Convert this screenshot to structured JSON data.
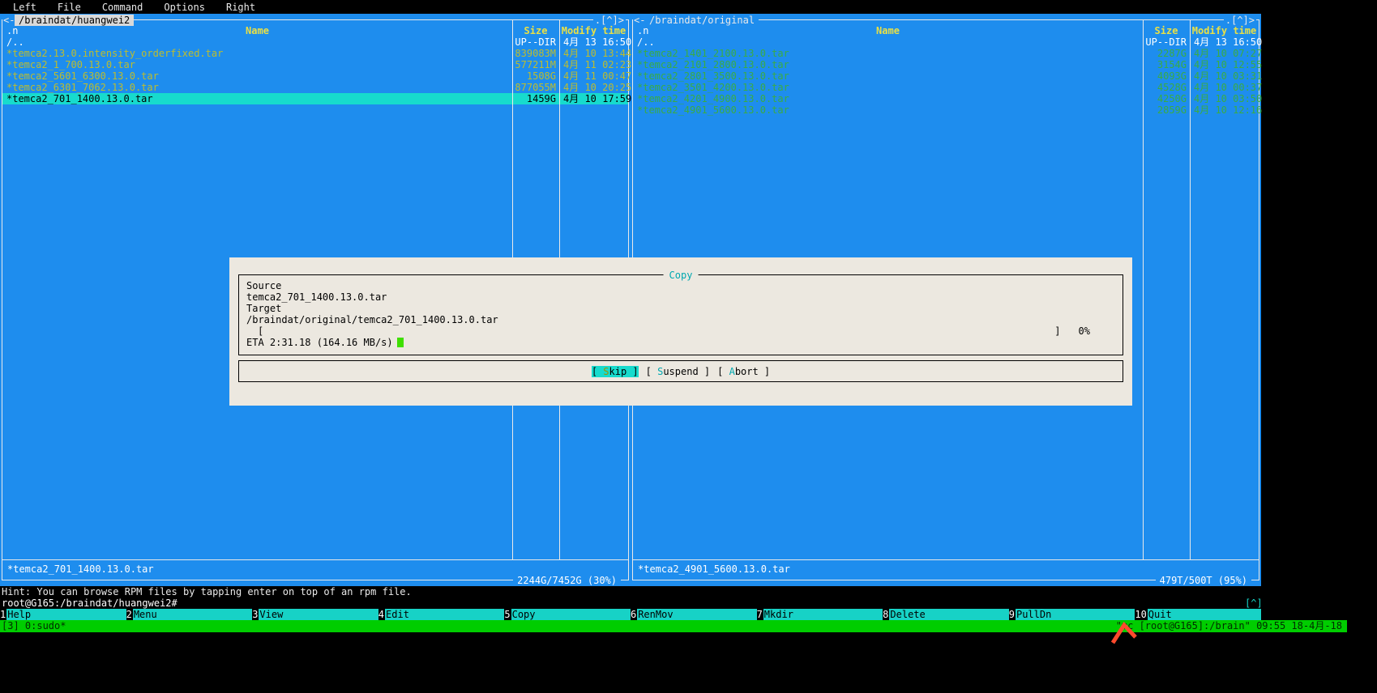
{
  "colors": {
    "panel_bg": "#1e8dee",
    "panel_frame": "#e9e9e9",
    "column_header_text": "#e9e045",
    "left_files_text": "#bdbd2e",
    "right_files_text": "#3aac43",
    "selection_bg": "#17dbcd",
    "dialog_bg": "#ece8e0",
    "dialog_title_text": "#00a8b0",
    "fkey_label_bg": "#17d2c6",
    "statusbar_bg": "#00cd00",
    "eta_cursor": "#3fdf00"
  },
  "menu_bar": {
    "items": [
      "Left",
      "File",
      "Command",
      "Options",
      "Right"
    ]
  },
  "left_panel": {
    "arrow": "<-",
    "path": "/braindat/huangwei2",
    "corner": ".[^]>",
    "sort_indicator": ".n",
    "columns": {
      "name": "Name",
      "size": "Size",
      "mtime": "Modify time"
    },
    "rows": [
      {
        "name": "/..",
        "size": "UP--DIR",
        "mtime": "4月 13 16:50"
      },
      {
        "name": "*temca2.13.0.intensity_orderfixed.tar",
        "size": "839083M",
        "mtime": "4月 10 13:44"
      },
      {
        "name": "*temca2_1_700.13.0.tar",
        "size": "577211M",
        "mtime": "4月 11 02:23"
      },
      {
        "name": "*temca2_5601_6300.13.0.tar",
        "size": "1508G",
        "mtime": "4月 11 00:47"
      },
      {
        "name": "*temca2_6301_7062.13.0.tar",
        "size": "877055M",
        "mtime": "4月 10 20:25"
      },
      {
        "name": "*temca2_701_1400.13.0.tar",
        "size": "1459G",
        "mtime": "4月 10 17:59"
      }
    ],
    "mini_status": "*temca2_701_1400.13.0.tar",
    "summary": "2244G/7452G (30%)"
  },
  "right_panel": {
    "arrow": "<-",
    "path": "/braindat/original",
    "corner": ".[^]>",
    "sort_indicator": ".n",
    "columns": {
      "name": "Name",
      "size": "Size",
      "mtime": "Modify time"
    },
    "rows": [
      {
        "name": "/..",
        "size": "UP--DIR",
        "mtime": "4月 13 16:50"
      },
      {
        "name": "*temca2_1401_2100.13.0.tar",
        "size": "2287G",
        "mtime": "4月 10 07:27"
      },
      {
        "name": "*temca2_2101_2800.13.0.tar",
        "size": "3154G",
        "mtime": "4月 10 12:55"
      },
      {
        "name": "*temca2_2801_3500.13.0.tar",
        "size": "4093G",
        "mtime": "4月 10 03:31"
      },
      {
        "name": "*temca2_3501_4200.13.0.tar",
        "size": "4528G",
        "mtime": "4月 10 00:37"
      },
      {
        "name": "*temca2_4201_4900.13.0.tar",
        "size": "4250G",
        "mtime": "4月 10 03:50"
      },
      {
        "name": "*temca2_4901_5600.13.0.tar",
        "size": "2859G",
        "mtime": "4月 10 12:16"
      }
    ],
    "mini_status": "*temca2_4901_5600.13.0.tar",
    "summary": "479T/500T (95%)"
  },
  "copy_dialog": {
    "title": "Copy",
    "source_label": "Source",
    "source_value": "temca2_701_1400.13.0.tar",
    "target_label": "Target",
    "target_value": "/braindat/original/temca2_701_1400.13.0.tar",
    "progress_open": "[",
    "progress_close": "]",
    "progress_percent": "0%",
    "eta_text": "ETA 2:31.18 (164.16 MB/s)",
    "buttons": [
      {
        "pre": "[ ",
        "hotkey": "S",
        "rest": "kip ]"
      },
      {
        "pre": "[ ",
        "hotkey": "S",
        "rest": "uspend ]"
      },
      {
        "pre": "[ ",
        "hotkey": "A",
        "rest": "bort ]"
      }
    ]
  },
  "hint_line": "Hint: You can browse RPM files by tapping enter on top of an rpm file.",
  "command_prompt": "root@G165:/braindat/huangwei2#",
  "corner_marker": "[^]",
  "function_keys": [
    {
      "num": "1",
      "label": "Help"
    },
    {
      "num": "2",
      "label": "Menu"
    },
    {
      "num": "3",
      "label": "View"
    },
    {
      "num": "4",
      "label": "Edit"
    },
    {
      "num": "5",
      "label": "Copy"
    },
    {
      "num": "6",
      "label": "RenMov"
    },
    {
      "num": "7",
      "label": "Mkdir"
    },
    {
      "num": "8",
      "label": "Delete"
    },
    {
      "num": "9",
      "label": "PullDn"
    },
    {
      "num": "10",
      "label": "Quit"
    }
  ],
  "status_bar": {
    "left": "[3] 0:sudo*",
    "right": "\"mc [root@G165]:/brain\" 09:55 18-4月-18"
  }
}
